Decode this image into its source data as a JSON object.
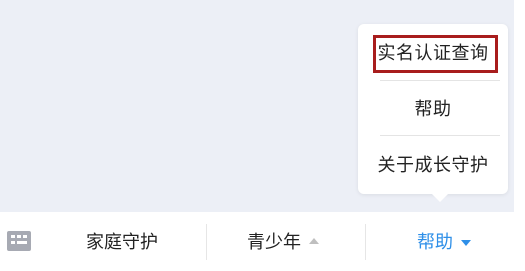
{
  "popup": {
    "items": [
      {
        "label": "实名认证查询"
      },
      {
        "label": "帮助"
      },
      {
        "label": "关于成长守护"
      }
    ]
  },
  "tabbar": {
    "keyboard_icon": "keyboard-icon",
    "tabs": [
      {
        "label": "家庭守护"
      },
      {
        "label": "青少年"
      },
      {
        "label": "帮助"
      }
    ]
  },
  "colors": {
    "content_bg": "#eceff6",
    "highlight_border": "#a81d1d",
    "active_tab": "#2e8fe8",
    "inactive_caret": "#bfbfbf"
  }
}
